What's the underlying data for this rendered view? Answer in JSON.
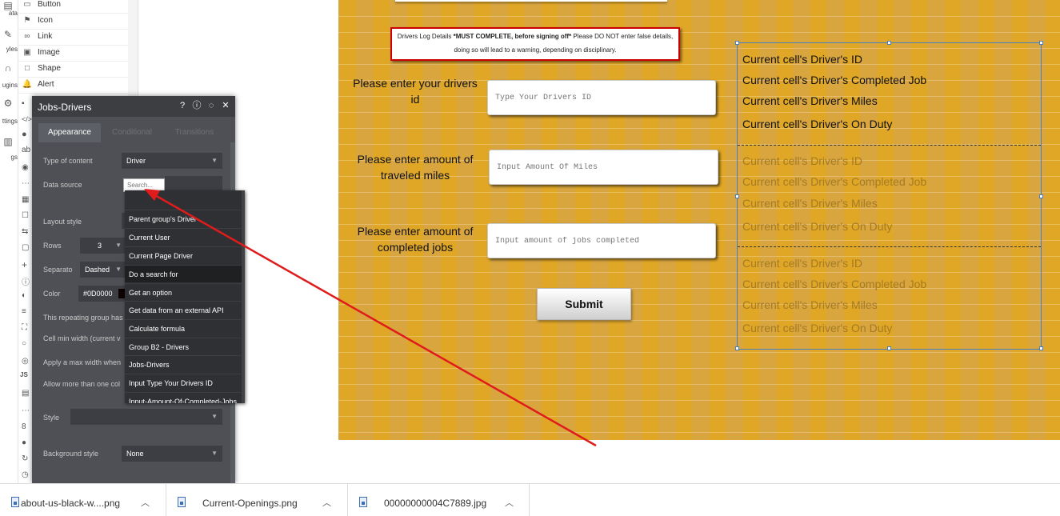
{
  "rail": [
    {
      "label": "ata",
      "icon": "database-icon"
    },
    {
      "label": "yles",
      "icon": "brush-icon"
    },
    {
      "label": "ugins",
      "icon": "plug-icon"
    },
    {
      "label": "ttings",
      "icon": "gear-icon"
    },
    {
      "label": "gs",
      "icon": "document-icon"
    }
  ],
  "palette": {
    "items": [
      {
        "label": "Button",
        "icon": "button-icon"
      },
      {
        "label": "Icon",
        "icon": "flag-icon"
      },
      {
        "label": "Link",
        "icon": "link-icon"
      },
      {
        "label": "Image",
        "icon": "image-icon"
      },
      {
        "label": "Shape",
        "icon": "shape-icon"
      },
      {
        "label": "Alert",
        "icon": "bell-icon"
      }
    ]
  },
  "editor": {
    "title": "Jobs-Drivers",
    "tabs": [
      "Appearance",
      "Conditional",
      "Transitions"
    ],
    "type_of_content_label": "Type of content",
    "type_of_content_value": "Driver",
    "data_source_label": "Data source",
    "data_source_placeholder": "Search...",
    "layout_style_label": "Layout style",
    "rows_label": "Rows",
    "rows_value": "3",
    "separator_label": "Separato",
    "separator_value": "Dashed",
    "color_label": "Color",
    "color_value": "#0D0000",
    "repeating_note": "This repeating group has",
    "cell_min_width": "Cell min width (current v",
    "max_width": "Apply a max width when",
    "allow_more": "Allow more than one col",
    "style_label": "Style",
    "background_style_label": "Background style",
    "background_style_value": "None"
  },
  "dropdown": {
    "items": [
      "Parent group's Driver",
      "Current User",
      "Current Page Driver",
      "Do a search for",
      "Get an option",
      "Get data from an external API",
      "Calculate formula",
      "Group B2 - Drivers",
      "Jobs-Drivers",
      "Input Type Your Drivers ID",
      "Input-Amount-Of-Completed-Jobs"
    ],
    "highlighted": 3
  },
  "canvas": {
    "warning_pre": "Drivers Log Details ",
    "warning_bold": "*MUST COMPLETE, before signing off*",
    "warning_post": " Please DO NOT enter false details, doing so will lead to a warning, depending on disciplinary.",
    "label_driver_id": "Please enter your drivers id",
    "placeholder_driver_id": "Type Your Drivers ID",
    "label_miles": "Please enter amount of traveled miles",
    "placeholder_miles": "Input Amount Of Miles",
    "label_jobs": "Please enter amount of completed jobs",
    "placeholder_jobs": "Input amount of jobs completed",
    "submit_label": "Submit",
    "rg_lines": [
      "Current cell's Driver's ID",
      "Current cell's Driver's Completed Job",
      "Current cell's Driver's Miles",
      "Current cell's Driver's On Duty"
    ]
  },
  "downloads": [
    {
      "name": "about-us-black-w....png"
    },
    {
      "name": "Current-Openings.png"
    },
    {
      "name": "00000000004C7889.jpg"
    }
  ],
  "colors": {
    "canvas_bg": "#d8a53f",
    "arrow": "#e01b1b",
    "selection": "#4a7fbf"
  }
}
